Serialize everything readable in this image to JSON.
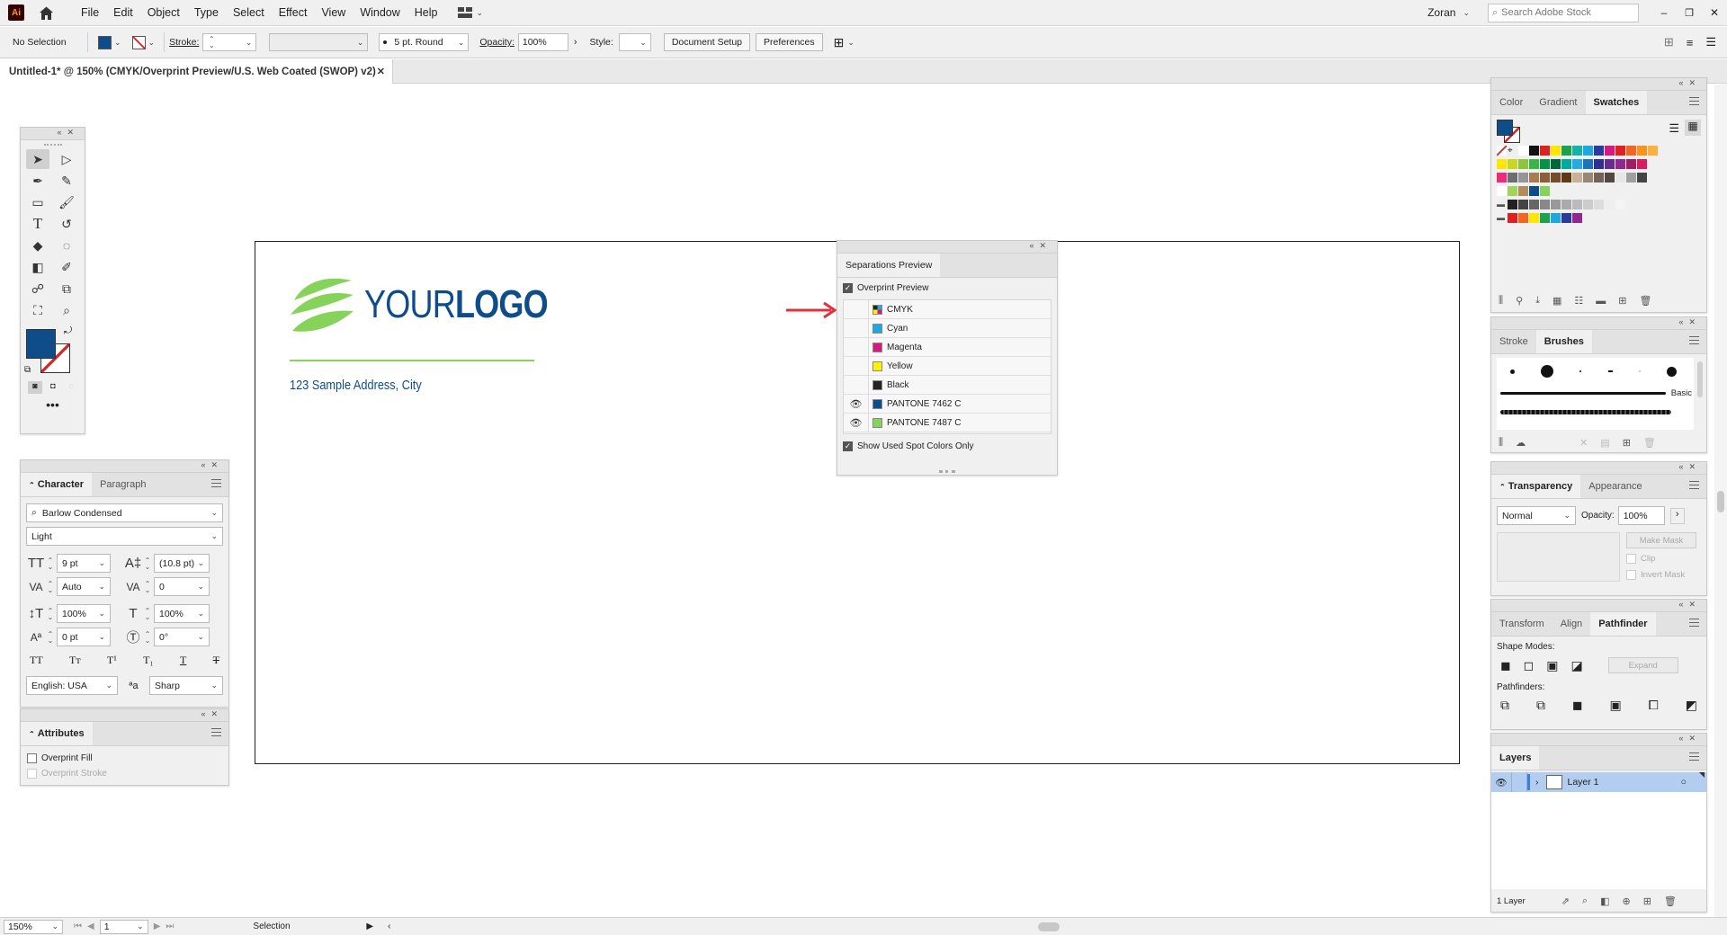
{
  "app": {
    "logo": "Ai",
    "user": "Zoran",
    "search_placeholder": "Search Adobe Stock"
  },
  "menu": [
    "File",
    "Edit",
    "Object",
    "Type",
    "Select",
    "Effect",
    "View",
    "Window",
    "Help"
  ],
  "control": {
    "selection": "No Selection",
    "stroke_label": "Stroke:",
    "brush": "5 pt. Round",
    "opacity_label": "Opacity:",
    "opacity": "100%",
    "style_label": "Style:",
    "doc_setup": "Document Setup",
    "preferences": "Preferences"
  },
  "document": {
    "tab_title": "Untitled-1* @ 150% (CMYK/Overprint Preview/U.S. Web Coated (SWOP) v2)"
  },
  "artwork": {
    "logo_light": "YOUR",
    "logo_bold": "LOGO",
    "address": "123 Sample Address, City",
    "brand_color": "#0f4c8a",
    "leaf_color": "#86d35c"
  },
  "character": {
    "tabs": [
      "Character",
      "Paragraph"
    ],
    "font_family": "Barlow Condensed",
    "font_style": "Light",
    "size": "9 pt",
    "leading": "(10.8 pt)",
    "kerning": "Auto",
    "tracking": "0",
    "vscale": "100%",
    "hscale": "100%",
    "baseline": "0 pt",
    "rotation": "0°",
    "language": "English: USA",
    "aa": "Sharp"
  },
  "attributes": {
    "title": "Attributes",
    "overprint_fill": "Overprint Fill",
    "overprint_stroke": "Overprint Stroke"
  },
  "separations": {
    "title": "Separations Preview",
    "overprint_preview": "Overprint Preview",
    "rows": [
      {
        "name": "CMYK",
        "color": "#cmyk",
        "eye": false
      },
      {
        "name": "Cyan",
        "color": "#1ea7e0",
        "eye": false
      },
      {
        "name": "Magenta",
        "color": "#d9187f",
        "eye": false
      },
      {
        "name": "Yellow",
        "color": "#fff200",
        "eye": false
      },
      {
        "name": "Black",
        "color": "#222222",
        "eye": false
      },
      {
        "name": "PANTONE 7462 C",
        "color": "#0f4c8a",
        "eye": true
      },
      {
        "name": "PANTONE 7487 C",
        "color": "#86d35c",
        "eye": true
      }
    ],
    "show_spot": "Show Used Spot Colors Only"
  },
  "swatches": {
    "tabs": [
      "Color",
      "Gradient",
      "Swatches"
    ]
  },
  "stroke_panel": {
    "tabs": [
      "Stroke",
      "Brushes"
    ],
    "basic": "Basic"
  },
  "transparency": {
    "tabs": [
      "Transparency",
      "Appearance"
    ],
    "mode": "Normal",
    "opacity_label": "Opacity:",
    "opacity": "100%",
    "make_mask": "Make Mask",
    "clip": "Clip",
    "invert": "Invert Mask"
  },
  "pathfinder": {
    "tabs": [
      "Transform",
      "Align",
      "Pathfinder"
    ],
    "shape_modes": "Shape Modes:",
    "pathfinders": "Pathfinders:",
    "expand": "Expand"
  },
  "layers": {
    "title": "Layers",
    "layer_name": "Layer 1",
    "count": "1 Layer"
  },
  "status": {
    "zoom": "150%",
    "artboard": "1",
    "tool": "Selection"
  }
}
